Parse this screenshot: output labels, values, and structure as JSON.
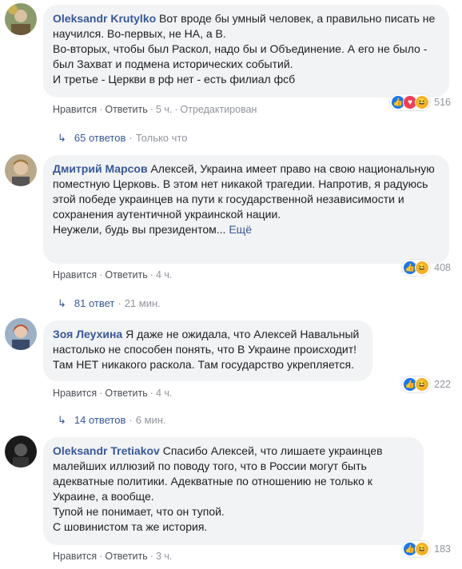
{
  "comments": [
    {
      "author": "Oleksandr Krutylko",
      "text": "Вот вроде бы умный человек, а правильно писать не научился. Во-первых, не НА, а В.",
      "text2": "Во-вторых, чтобы был Раскол, надо бы и Объединение. А его не было - был Захват и подмена исторических событий.",
      "text3": "И третье - Церкви в рф нет - есть филиал фсб",
      "like": "Нравится",
      "reply": "Ответить",
      "time": "5 ч.",
      "edited": "Отредактирован",
      "reactions": "516",
      "replies": "65 ответов",
      "replies_time": "Только что"
    },
    {
      "author": "Дмитрий Марсов",
      "text": "Алексей, Украина имеет право на свою национальную поместную Церковь. В этом нет никакой трагедии. Напротив, я радуюсь этой победе украинцев на пути к государственной независимости и сохранения аутентичной украинской нации.",
      "text2": "Неужели, будь вы президентом...",
      "more": "Ещё",
      "like": "Нравится",
      "reply": "Ответить",
      "time": "4 ч.",
      "reactions": "408",
      "replies": "81 ответ",
      "replies_time": "21 мин."
    },
    {
      "author": "Зоя Леухина",
      "text": "Я даже не ожидала, что Алексей Навальный настолько не способен понять, что В Украине происходит! Там НЕТ никакого раскола. Там государство укрепляется.",
      "like": "Нравится",
      "reply": "Ответить",
      "time": "4 ч.",
      "reactions": "222",
      "replies": "14 ответов",
      "replies_time": "6 мин."
    },
    {
      "author": "Oleksandr Tretiakov",
      "text": "Спасибо Алексей, что лишаете украинцев малейших иллюзий по поводу того, что в России могут быть адекватные политики. Адекватные по отношению не только к Украине, а вообще.",
      "text2": "Тупой не понимает, что он тупой.",
      "text3": "С шовинистом та же история.",
      "like": "Нравится",
      "reply": "Ответить",
      "time": "3 ч.",
      "reactions": "183"
    }
  ],
  "colors": {
    "link": "#385898",
    "bubble": "#f2f3f5",
    "meta": "#90949c",
    "like": "#1877f2",
    "love": "#f33e58",
    "haha": "#f7b125"
  }
}
